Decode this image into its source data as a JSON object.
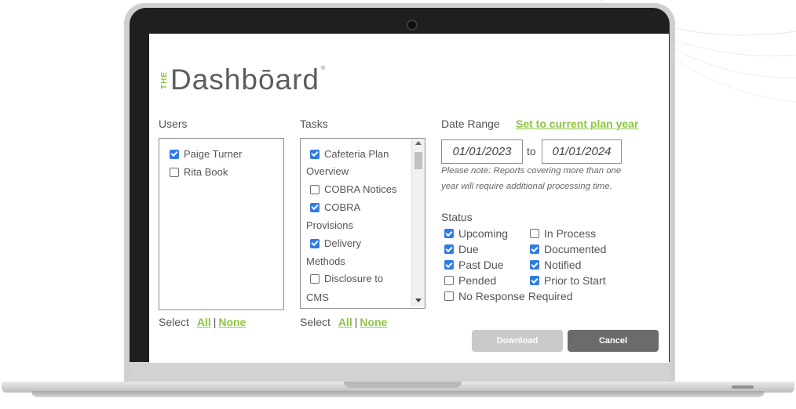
{
  "app": {
    "logo_prefix": "THE",
    "logo_word": "Dashbōard",
    "logo_reg": "®"
  },
  "colors": {
    "accent": "#8dc63f",
    "checkbox": "#2f7be6",
    "download_btn": "#c9c9c9",
    "cancel_btn": "#6b6b6b"
  },
  "users": {
    "label": "Users",
    "items": [
      {
        "label": "Paige Turner",
        "checked": true
      },
      {
        "label": "Rita Book",
        "checked": false
      }
    ],
    "select_label": "Select",
    "all": "All",
    "sep": "|",
    "none": "None"
  },
  "tasks": {
    "label": "Tasks",
    "items": [
      {
        "line1": "Cafeteria Plan",
        "line2": "Overview",
        "checked": true
      },
      {
        "line1": "COBRA Notices",
        "checked": false
      },
      {
        "line1": "COBRA",
        "line2": "Provisions",
        "checked": true
      },
      {
        "line1": "Delivery",
        "line2": "Methods",
        "checked": true
      },
      {
        "line1": "Disclosure to",
        "line2": "CMS",
        "checked": false
      }
    ],
    "select_label": "Select",
    "all": "All",
    "sep": "|",
    "none": "None"
  },
  "date_range": {
    "label": "Date Range",
    "set_link": "Set to current plan year",
    "from": "01/01/2023",
    "to_label": "to",
    "to": "01/01/2024",
    "note_line1": "Please note: Reports covering more than one",
    "note_line2": "year will require additional processing time."
  },
  "status": {
    "label": "Status",
    "items": [
      {
        "label": "Upcoming",
        "checked": true
      },
      {
        "label": "In Process",
        "checked": false
      },
      {
        "label": "Due",
        "checked": true
      },
      {
        "label": "Documented",
        "checked": true
      },
      {
        "label": "Past Due",
        "checked": true
      },
      {
        "label": "Notified",
        "checked": true
      },
      {
        "label": "Pended",
        "checked": false
      },
      {
        "label": "Prior to Start",
        "checked": true
      },
      {
        "label": "No Response Required",
        "checked": false
      }
    ]
  },
  "buttons": {
    "download": "Download",
    "cancel": "Cancel"
  }
}
